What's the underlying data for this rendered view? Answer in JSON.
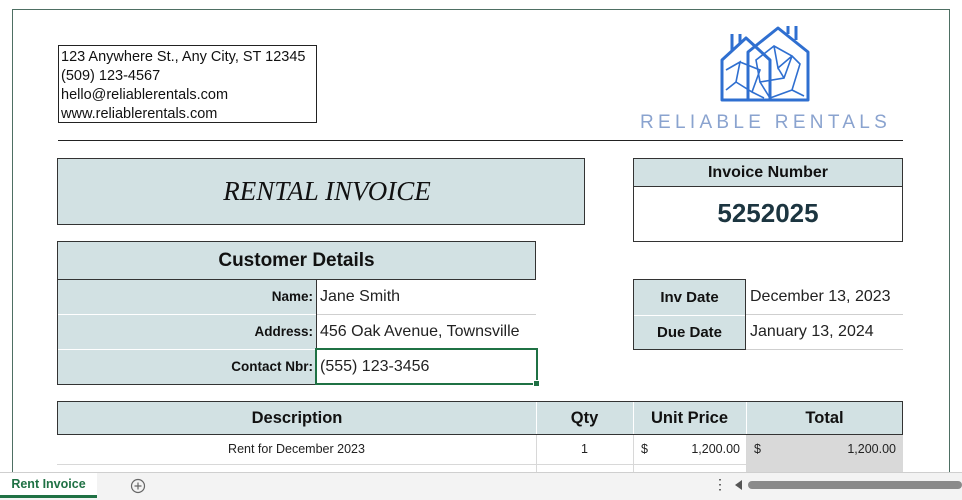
{
  "company": {
    "address": "123 Anywhere St., Any City, ST 12345",
    "phone": "(509) 123-4567",
    "email": "hello@reliablerentals.com",
    "website": "www.reliablerentals.com",
    "brand": "RELIABLE RENTALS",
    "logo_icon": "house-outline-logo-icon",
    "brand_color": "#2f6fd0"
  },
  "invoice": {
    "title": "RENTAL INVOICE",
    "number_label": "Invoice Number",
    "number": "5252025",
    "inv_date_label": "Inv Date",
    "inv_date": "December 13, 2023",
    "due_date_label": "Due Date",
    "due_date": "January 13, 2024"
  },
  "customer": {
    "heading": "Customer Details",
    "name_label": "Name:",
    "name": "Jane Smith",
    "address_label": "Address:",
    "address": "456 Oak Avenue, Townsville",
    "contact_label": "Contact Nbr:",
    "contact": "(555) 123-3456"
  },
  "table": {
    "headers": [
      "Description",
      "Qty",
      "Unit Price",
      "Total"
    ],
    "rows": [
      {
        "description": "Rent for December 2023",
        "qty": "1",
        "unit_currency": "$",
        "unit_price": "1,200.00",
        "total_currency": "$",
        "total": "1,200.00"
      }
    ]
  },
  "bottom": {
    "sheet_tab": "Rent Invoice",
    "add_sheet_icon": "plus-circle-icon",
    "more_icon": "vertical-dots-icon"
  },
  "colors": {
    "header_fill": "#d2e1e3",
    "selection": "#1f7144",
    "total_fill": "#d9d9d9"
  }
}
